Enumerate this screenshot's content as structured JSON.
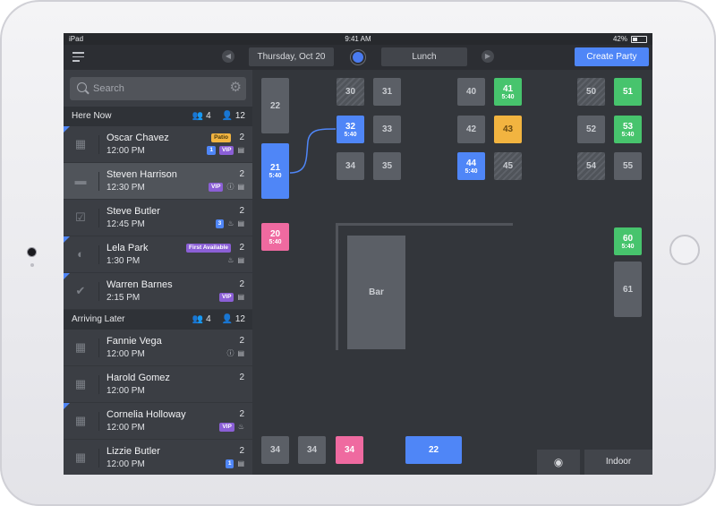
{
  "status_bar": {
    "device": "iPad",
    "time": "9:41 AM",
    "battery": "42%"
  },
  "header": {
    "date": "Thursday, Oct 20",
    "service": "Lunch",
    "create_label": "Create Party"
  },
  "search": {
    "placeholder": "Search"
  },
  "sections": {
    "here_now": {
      "title": "Here Now",
      "parties": "4",
      "guests": "12"
    },
    "arriving_later": {
      "title": "Arriving Later",
      "parties": "4",
      "guests": "12"
    }
  },
  "here_now": [
    {
      "name": "Oscar Chavez",
      "time": "12:00 PM",
      "count": "2",
      "tag": "Patio",
      "num_badge": "1",
      "vip": "VIP"
    },
    {
      "name": "Steven Harrison",
      "time": "12:30 PM",
      "count": "2",
      "vip": "VIP"
    },
    {
      "name": "Steve Butler",
      "time": "12:45 PM",
      "count": "2",
      "num_badge": "3"
    },
    {
      "name": "Lela Park",
      "time": "1:30 PM",
      "count": "2",
      "tag": "First Available"
    },
    {
      "name": "Warren Barnes",
      "time": "2:15 PM",
      "count": "2",
      "vip": "VIP"
    }
  ],
  "arriving_later": [
    {
      "name": "Fannie Vega",
      "time": "12:00 PM",
      "count": "2"
    },
    {
      "name": "Harold Gomez",
      "time": "12:00 PM",
      "count": "2"
    },
    {
      "name": "Cornelia Holloway",
      "time": "12:00 PM",
      "count": "2",
      "vip": "VIP"
    },
    {
      "name": "Lizzie Butler",
      "time": "12:00 PM",
      "count": "2",
      "num_badge": "1"
    }
  ],
  "tables": {
    "t22a": {
      "label": "22"
    },
    "t21": {
      "label": "21",
      "time": "5:40"
    },
    "t20": {
      "label": "20",
      "time": "5:40"
    },
    "t30": {
      "label": "30"
    },
    "t31": {
      "label": "31"
    },
    "t32": {
      "label": "32",
      "time": "5:40"
    },
    "t33": {
      "label": "33"
    },
    "t34a": {
      "label": "34"
    },
    "t35": {
      "label": "35"
    },
    "t40": {
      "label": "40"
    },
    "t41": {
      "label": "41",
      "time": "5:40"
    },
    "t42": {
      "label": "42"
    },
    "t43": {
      "label": "43"
    },
    "t44": {
      "label": "44",
      "time": "5:40"
    },
    "t45": {
      "label": "45"
    },
    "t50": {
      "label": "50"
    },
    "t51": {
      "label": "51"
    },
    "t52": {
      "label": "52"
    },
    "t53": {
      "label": "53",
      "time": "5:40"
    },
    "t54": {
      "label": "54"
    },
    "t55": {
      "label": "55"
    },
    "t60": {
      "label": "60",
      "time": "5:40"
    },
    "t61": {
      "label": "61"
    },
    "b34a": {
      "label": "34"
    },
    "b34b": {
      "label": "34"
    },
    "b34c": {
      "label": "34"
    },
    "b22": {
      "label": "22"
    }
  },
  "bar_label": "Bar",
  "view_toggle": {
    "room": "Indoor"
  },
  "colors": {
    "accent": "#4f86f7",
    "seated_green": "#47c46d",
    "warning_orange": "#f2b440",
    "pink": "#ef6aa0",
    "vip": "#8b5fd6"
  }
}
